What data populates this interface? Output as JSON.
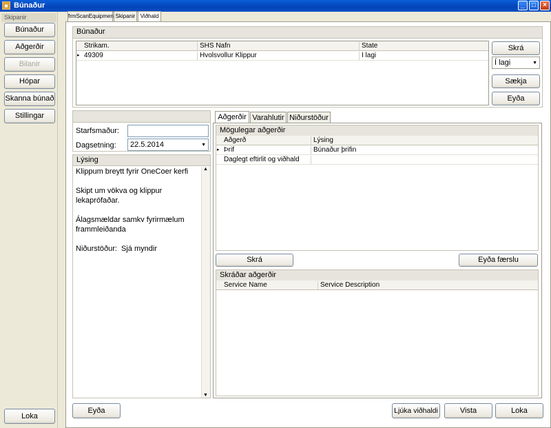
{
  "window": {
    "title": "Búnaður"
  },
  "sidebar": {
    "header": "Skipanir",
    "buttons": {
      "bunadur": "Búnaður",
      "adgerdir": "Aðgerðir",
      "bilanir": "Bilanir",
      "hopar": "Hópar",
      "skanna": "Skanna búnað",
      "stillingar": "Stillingar",
      "loka": "Loka"
    }
  },
  "tabs": {
    "t1": "frmScanEquipment",
    "t2": "Skipanir",
    "t3": "Viðhald"
  },
  "bunadur": {
    "title": "Búnaður",
    "columns": {
      "c1": "Strikam.",
      "c2": "SHS Nafn",
      "c3": "State"
    },
    "rows": [
      {
        "strikam": "49309",
        "nafn": "Hvolsvollur Klippur",
        "state": "Í lagi"
      }
    ],
    "skra": "Skrá",
    "state_select": "Í lagi",
    "saekja": "Sækja",
    "eyda": "Eyða"
  },
  "form": {
    "starfsmadur_label": "Starfsmaður:",
    "starfsmadur_value": "",
    "dagsetning_label": "Dagsetning:",
    "dagsetning_value": "22.5.2014"
  },
  "lysing": {
    "title": "Lýsing",
    "text": "Klippum breytt fyrir OneCoer kerfi\n\nSkipt um vökva og klippur lekaprófaðar.\n\nÁlagsmældar samkv fyrirmælum\nframmleiðanda\n\nNiðurstöður:  Sjá myndir"
  },
  "innertabs": {
    "a": "Aðgerðir",
    "b": "Varahlutir",
    "c": "Niðurstöður"
  },
  "moguleg": {
    "title": "Mögulegar aðgerðir",
    "columns": {
      "c1": "Aðgerð",
      "c2": "Lýsing"
    },
    "rows": [
      {
        "adgerd": "Þrif",
        "lysing": "Búnaður þrifin"
      },
      {
        "adgerd": "Daglegt eftirlit og viðhald",
        "lysing": ""
      }
    ]
  },
  "mid_buttons": {
    "skra": "Skrá",
    "eyda_faerslu": "Eyða færslu"
  },
  "skradar": {
    "title": "Skráðar aðgerðir",
    "columns": {
      "c1": "Service Name",
      "c2": "Service Description"
    }
  },
  "bottom": {
    "eyda": "Eyða",
    "ljuka": "Ljúka viðhaldi",
    "vista": "Vista",
    "loka": "Loka"
  }
}
